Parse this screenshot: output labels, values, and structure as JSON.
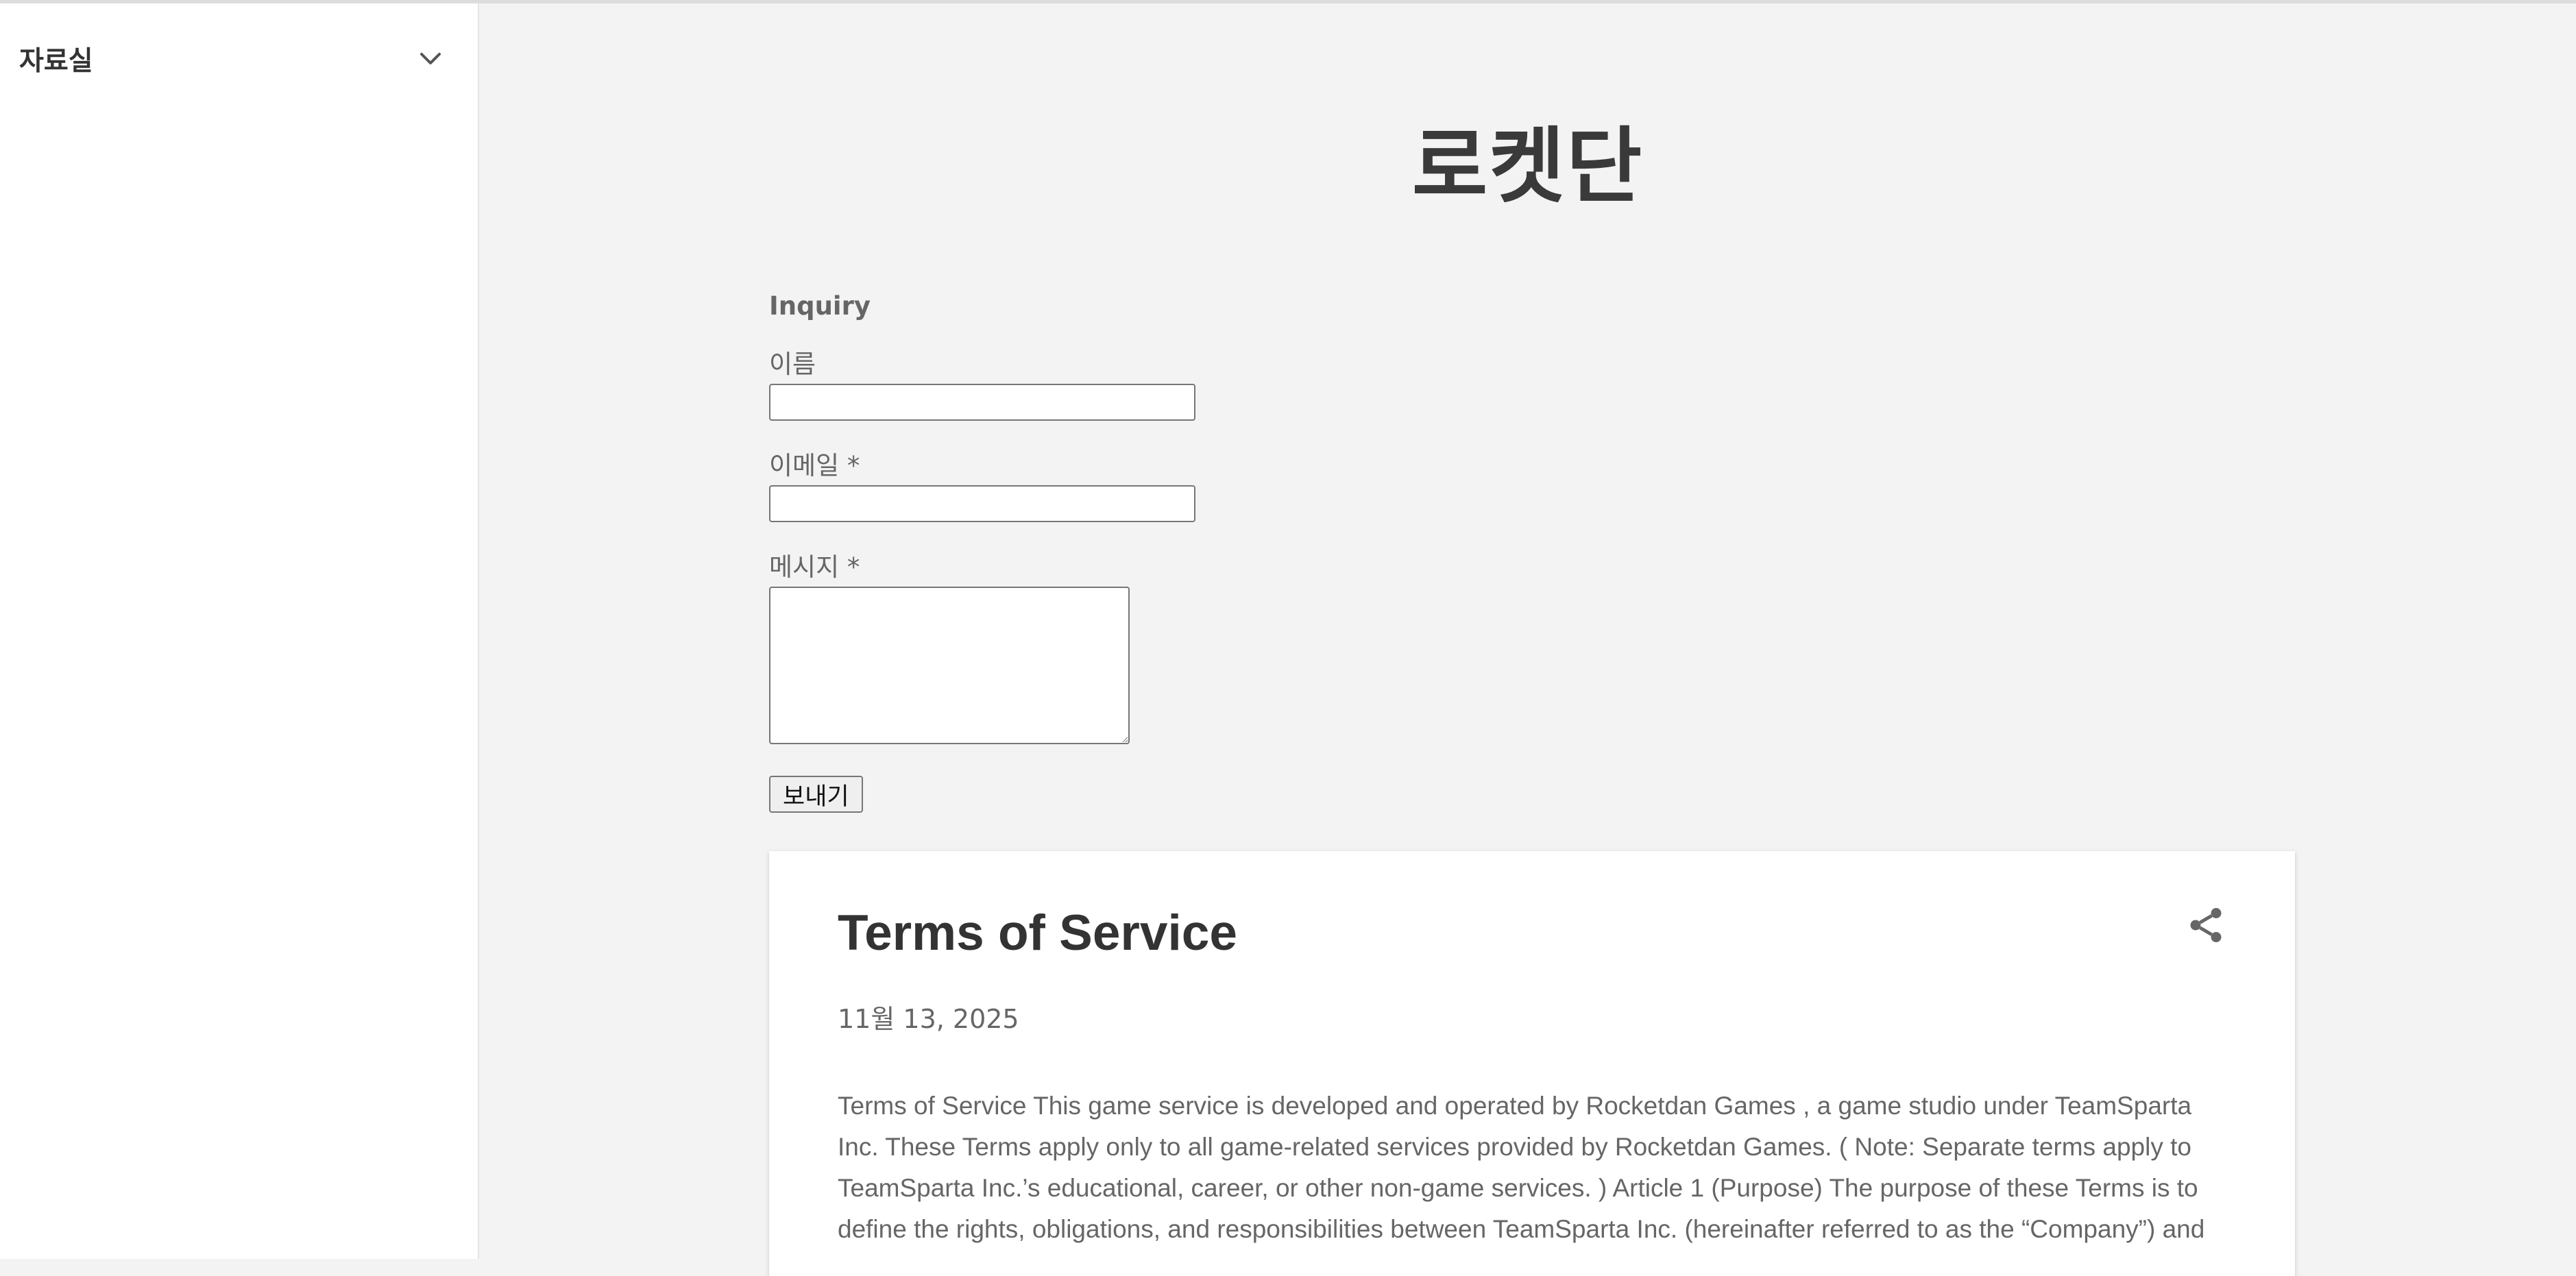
{
  "sidebar": {
    "title": "자료실",
    "toggle_icon": "chevron-down-icon"
  },
  "blog": {
    "title": "로켓단"
  },
  "contact_form": {
    "heading": "Inquiry",
    "name_label": "이름",
    "email_label": "이메일 *",
    "message_label": "메시지 *",
    "send_label": "보내기"
  },
  "post": {
    "title": "Terms of Service",
    "date": "11월 13, 2025",
    "share_icon": "share-icon",
    "body": "  Terms of Service This game service is developed and operated by Rocketdan Games , a game studio under TeamSparta Inc. These Terms apply only to all game-related services provided by Rocketdan Games. ( Note: Separate terms apply to TeamSparta Inc.’s educational, career, or other non-game services. ) Article 1 (Purpose) The purpose of these Terms is to define the rights, obligations, and responsibilities between TeamSparta Inc. (hereinafter referred to as the “Company”) and"
  }
}
